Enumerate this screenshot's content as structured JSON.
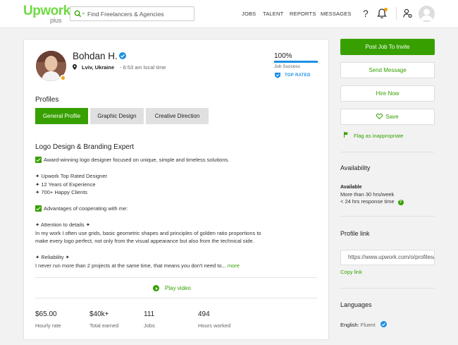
{
  "header": {
    "logo": "Upwork",
    "logo_sub": "plus",
    "search_placeholder": "Find Freelancers & Agencies",
    "nav": [
      "JOBS",
      "TALENT",
      "REPORTS",
      "MESSAGES"
    ],
    "help": "?"
  },
  "profile": {
    "name": "Bohdan H.",
    "location": "Lviv, Ukraine",
    "local_time": "- 6:53 am local time",
    "job_success_value": "100%",
    "job_success_percent": 100,
    "job_success_label": "Job Success",
    "top_rated": "TOP RATED",
    "profiles_heading": "Profiles",
    "tabs": [
      "General Profile",
      "Graphic Design",
      "Creative Direction"
    ],
    "title": "Logo Design & Branding Expert",
    "description": {
      "l1": "Award-winning logo designer focused on unique, simple and timeless solutions.",
      "l2": "✦ Upwork Top Rated Designer",
      "l3": "✦ 12 Years of Experience",
      "l4": "✦ 700+ Happy Clients",
      "l5": "Advantages of cooperating with me:",
      "l6": "✦ Attention to details ✦",
      "l7": "In my work I often use grids, basic geometric shapes and principles of golden ratio proportions to",
      "l8": "make every logo perfect, not only from the visual appearance but also from the technical side.",
      "l9": "✦ Reliability ✦",
      "l10": "I never run more than 2 projects at the same time, that means you don't need to...",
      "more": "more"
    },
    "play_video": "Play video",
    "stats": [
      {
        "value": "$65.00",
        "label": "Hourly rate"
      },
      {
        "value": "$40k+",
        "label": "Total earned"
      },
      {
        "value": "111",
        "label": "Jobs"
      },
      {
        "value": "494",
        "label": "Hours worked"
      }
    ]
  },
  "sidebar": {
    "post_job": "Post Job To Invite",
    "send_message": "Send Message",
    "hire_now": "Hire Now",
    "save": "Save",
    "flag": "Flag as inappropriate",
    "availability_heading": "Availability",
    "availability_title": "Available",
    "availability_hours": "More than 30 hrs/week",
    "availability_response": "< 24 hrs response time",
    "profile_link_heading": "Profile link",
    "profile_link_value": "https://www.upwork.com/o/profiles/users/",
    "copy_link": "Copy link",
    "languages_heading": "Languages",
    "language": "English:",
    "language_level": "Fluent"
  },
  "colors": {
    "brand_green": "#37a000",
    "logo_green": "#6fda44",
    "accent_blue": "#1d8fe5",
    "status_orange": "#f0a000"
  }
}
